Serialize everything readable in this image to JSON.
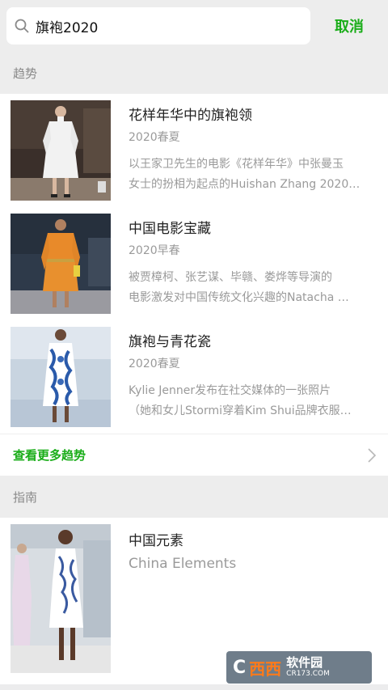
{
  "search": {
    "query": "旗袍2020",
    "cancel_label": "取消"
  },
  "trends": {
    "header": "趋势",
    "items": [
      {
        "title": "花样年华中的旗袍领",
        "season": "2020春夏",
        "desc_line1": "以王家卫先生的电影《花样年华》中张曼玉",
        "desc_line2": "女士的扮相为起点的Huishan Zhang 2020…"
      },
      {
        "title": "中国电影宝藏",
        "season": "2020早春",
        "desc_line1": "被贾樟柯、张艺谋、毕赣、娄烨等导演的",
        "desc_line2": "电影激发对中国传统文化兴趣的Natacha …"
      },
      {
        "title": "旗袍与青花瓷",
        "season": "2020春夏",
        "desc_line1": "Kylie Jenner发布在社交媒体的一张照片",
        "desc_line2": "（她和女儿Stormi穿着Kim Shui品牌衣服…"
      }
    ],
    "more_label": "查看更多趋势"
  },
  "guide": {
    "header": "指南",
    "items": [
      {
        "title": "中国元素",
        "subtitle": "China Elements"
      }
    ]
  },
  "watermark": {
    "logo": "C",
    "name": "西西",
    "brand": "软件园",
    "url": "CR173.COM"
  },
  "colors": {
    "accent": "#1aad19",
    "background": "#ededed",
    "card": "#ffffff",
    "secondary_text": "#9a9a9a"
  }
}
